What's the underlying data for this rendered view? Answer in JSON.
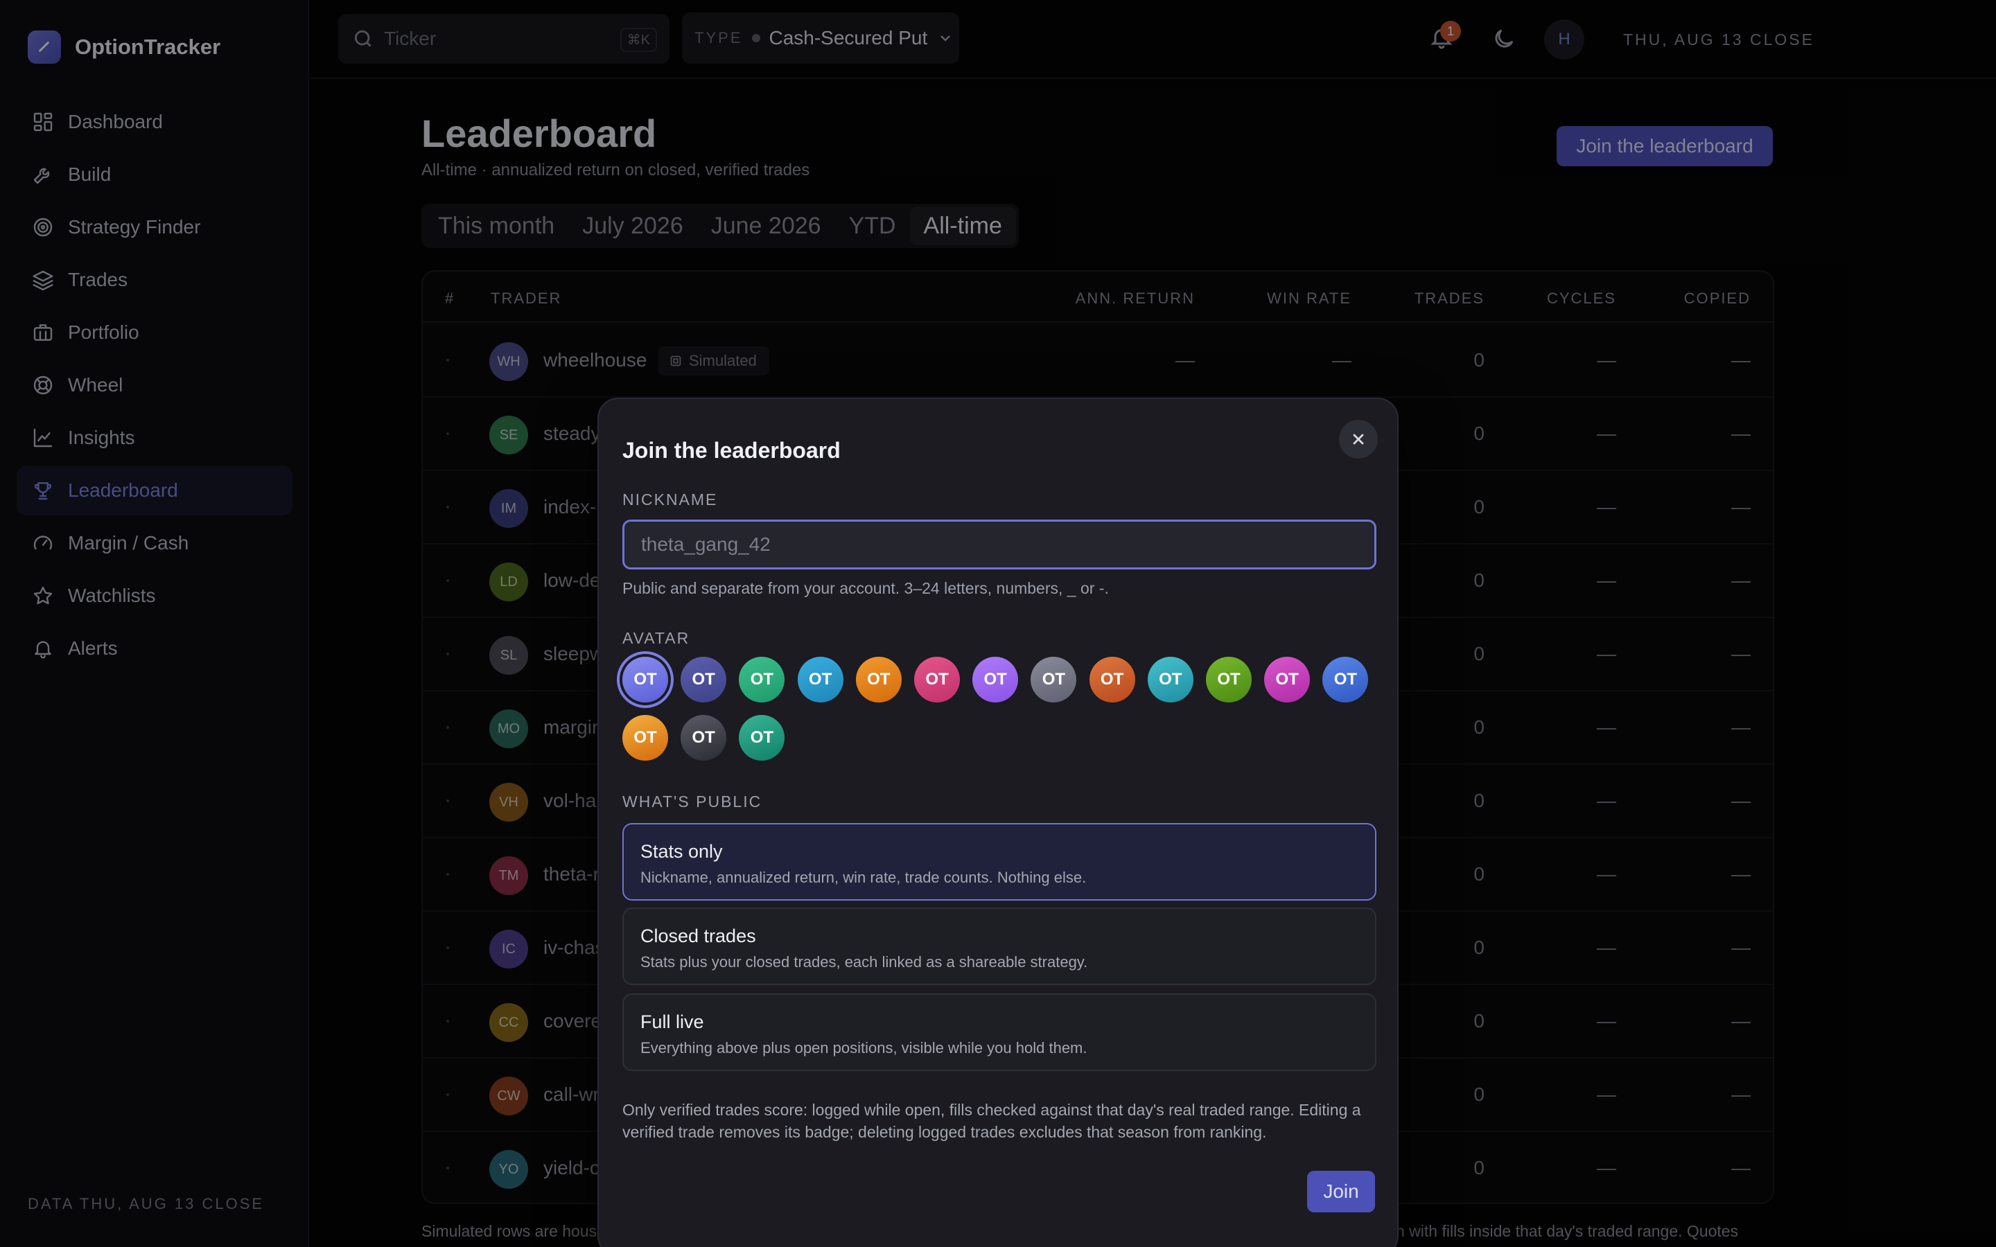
{
  "app": {
    "name": "OptionTracker",
    "data_footer": "DATA THU, AUG 13 CLOSE"
  },
  "sidebar": {
    "items": [
      {
        "label": "Dashboard",
        "icon": "grid-icon"
      },
      {
        "label": "Build",
        "icon": "wrench-icon"
      },
      {
        "label": "Strategy Finder",
        "icon": "target-icon"
      },
      {
        "label": "Trades",
        "icon": "layers-icon"
      },
      {
        "label": "Portfolio",
        "icon": "briefcase-icon"
      },
      {
        "label": "Wheel",
        "icon": "lifebuoy-icon"
      },
      {
        "label": "Insights",
        "icon": "line-chart-icon"
      },
      {
        "label": "Leaderboard",
        "icon": "trophy-icon",
        "active": true
      },
      {
        "label": "Margin / Cash",
        "icon": "gauge-icon"
      },
      {
        "label": "Watchlists",
        "icon": "star-icon"
      },
      {
        "label": "Alerts",
        "icon": "bell-icon"
      }
    ]
  },
  "topbar": {
    "search_placeholder": "Ticker",
    "search_shortcut": "⌘K",
    "type_label": "TYPE",
    "type_value": "Cash-Secured Put",
    "close_date": "THU, AUG 13 CLOSE",
    "notification_count": "1",
    "user_initial": "H"
  },
  "page": {
    "title": "Leaderboard",
    "subtitle": "All-time · annualized return on closed, verified trades",
    "join_button": "Join the leaderboard",
    "tabs": [
      "This month",
      "July 2026",
      "June 2026",
      "YTD",
      "All-time"
    ],
    "active_tab": "All-time",
    "note_left": "Simulated rows are hous",
    "note_right": "h with fills inside that day's traded range. Quotes"
  },
  "table": {
    "headers": {
      "rank": "#",
      "trader": "TRADER",
      "ann_return": "ANN. RETURN",
      "win_rate": "WIN RATE",
      "trades": "TRADES",
      "cycles": "CYCLES",
      "copied": "COPIED"
    },
    "rank_marker": "·",
    "simulated_label": "Simulated",
    "rows": [
      {
        "initials": "WH",
        "name": "wheelhouse",
        "ann_return": "—",
        "win_rate": "—",
        "trades": "0",
        "cycles": "—",
        "copied": "—",
        "color": "#4a4c8a"
      },
      {
        "initials": "SE",
        "name": "steady",
        "trades": "0",
        "cycles": "—",
        "copied": "—",
        "color": "#2f7a4e"
      },
      {
        "initials": "IM",
        "name": "index-r",
        "trades": "0",
        "cycles": "—",
        "copied": "—",
        "color": "#3a3f7c"
      },
      {
        "initials": "LD",
        "name": "low-de",
        "trades": "0",
        "cycles": "—",
        "copied": "—",
        "color": "#4a6a1e"
      },
      {
        "initials": "SL",
        "name": "sleepw",
        "trades": "0",
        "cycles": "—",
        "copied": "—",
        "color": "#4a4b55"
      },
      {
        "initials": "MO",
        "name": "margin",
        "trades": "0",
        "cycles": "—",
        "copied": "—",
        "color": "#2a6a5a"
      },
      {
        "initials": "VH",
        "name": "vol-har",
        "trades": "0",
        "cycles": "—",
        "copied": "—",
        "color": "#8a5a1a"
      },
      {
        "initials": "TM",
        "name": "theta-r",
        "trades": "0",
        "cycles": "—",
        "copied": "—",
        "color": "#8a2e46"
      },
      {
        "initials": "IC",
        "name": "iv-chas",
        "trades": "0",
        "cycles": "—",
        "copied": "—",
        "color": "#4e3e8e"
      },
      {
        "initials": "CC",
        "name": "covere",
        "trades": "0",
        "cycles": "—",
        "copied": "—",
        "color": "#8a6a1a"
      },
      {
        "initials": "CW",
        "name": "call-wr",
        "trades": "0",
        "cycles": "—",
        "copied": "—",
        "color": "#8a3e22"
      },
      {
        "initials": "YO",
        "name": "yield-c",
        "trades": "0",
        "cycles": "—",
        "copied": "—",
        "color": "#2a6a7a"
      }
    ]
  },
  "modal": {
    "title": "Join the leaderboard",
    "nickname_label": "NICKNAME",
    "nickname_placeholder": "theta_gang_42",
    "nickname_help": "Public and separate from your account. 3–24 letters, numbers, _ or -.",
    "avatar_label": "AVATAR",
    "avatar_text": "OT",
    "avatar_colors": [
      [
        "#5a5fd6",
        "#8a8ef0"
      ],
      [
        "#3e4188",
        "#5b5fae"
      ],
      [
        "#1e9a6c",
        "#3cc08c"
      ],
      [
        "#1e86b6",
        "#38aee0"
      ],
      [
        "#d46b0c",
        "#f29a2e"
      ],
      [
        "#c2306a",
        "#e4568c"
      ],
      [
        "#8a52e6",
        "#b07cf6"
      ],
      [
        "#5e6070",
        "#8a8c9a"
      ],
      [
        "#b8481c",
        "#de7840"
      ],
      [
        "#1c8ea2",
        "#4ac0cc"
      ],
      [
        "#4a8a12",
        "#78b82e"
      ],
      [
        "#b02aa8",
        "#d858c8"
      ],
      [
        "#2e58c2",
        "#5a86e8"
      ],
      [
        "#d46a0c",
        "#f4b040"
      ],
      [
        "#2a2b32",
        "#5a5b66"
      ],
      [
        "#12806a",
        "#38b494"
      ]
    ],
    "selected_avatar": 0,
    "public_label": "WHAT'S PUBLIC",
    "options": [
      {
        "title": "Stats only",
        "desc": "Nickname, annualized return, win rate, trade counts. Nothing else.",
        "selected": true
      },
      {
        "title": "Closed trades",
        "desc": "Stats plus your closed trades, each linked as a shareable strategy.",
        "selected": false
      },
      {
        "title": "Full live",
        "desc": "Everything above plus open positions, visible while you hold them.",
        "selected": false
      }
    ],
    "footnote": "Only verified trades score: logged while open, fills checked against that day's real traded range. Editing a verified trade removes its badge; deleting logged trades excludes that season from ranking.",
    "join_button": "Join"
  }
}
